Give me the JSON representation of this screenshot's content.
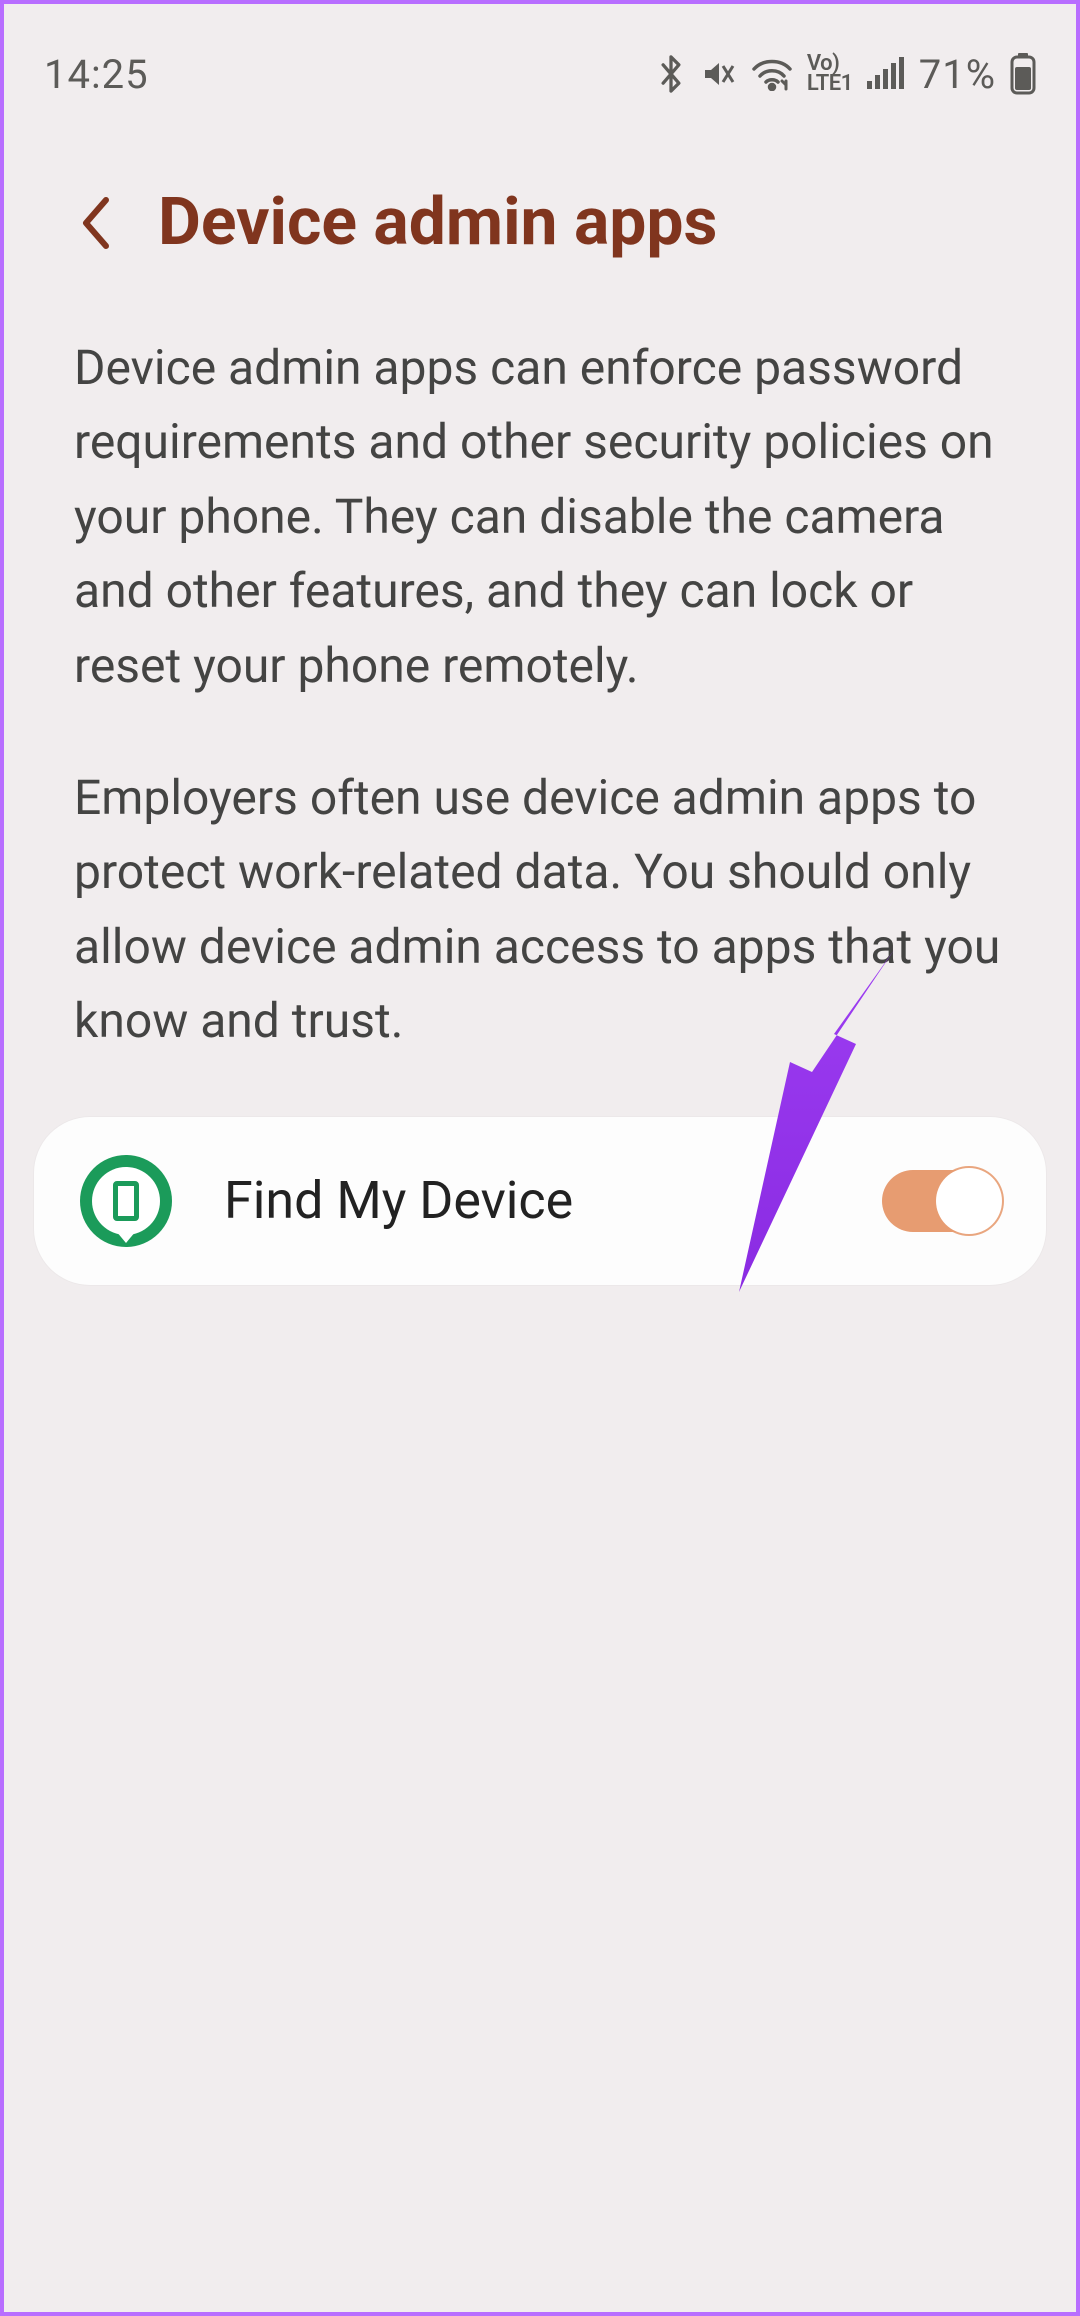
{
  "status": {
    "time": "14:25",
    "battery_pct": "71%"
  },
  "header": {
    "title": "Device admin apps"
  },
  "description": {
    "p1": "Device admin apps can enforce password requirements and other security policies on your phone. They can disable the camera and other features, and they can lock or reset your phone remotely.",
    "p2": "Employers often use device admin apps to protect work-related data. You should only allow device admin access to apps that you know and trust."
  },
  "apps": {
    "item0": {
      "label": "Find My Device",
      "enabled": true
    }
  }
}
